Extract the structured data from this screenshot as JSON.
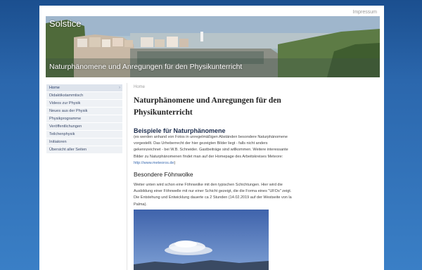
{
  "top_link": "Impressum",
  "header": {
    "title": "Solstice",
    "subtitle": "Naturphänomene und Anregungen für den Physikunterricht"
  },
  "sidebar": {
    "items": [
      {
        "label": "Home",
        "active": true
      },
      {
        "label": "Didaktikstammtisch"
      },
      {
        "label": "Videos zur Physik"
      },
      {
        "label": "Neues aus der Physik"
      },
      {
        "label": "Physikprogramme"
      },
      {
        "label": "Veröffentlichungen"
      },
      {
        "label": "Teilchenphysik"
      },
      {
        "label": "Initiatoren"
      },
      {
        "label": "Übersicht aller Seiten"
      }
    ],
    "active_arrow": "›"
  },
  "main": {
    "breadcrumb": "Home",
    "title": "Naturphänomene und Anregungen für den Physikunterricht",
    "section_heading": "Beispiele für Naturphänomene",
    "intro_text": "(es werden anhand von Fotos in unregelmäßigen Abständen besondere Naturphänomene vorgestellt. Das Urheberrecht der hier gezeigten Bilder liegt - falls nicht anders gekennzeichnet - bei W.B. Schneider. Gastbeiträge sind willkommen. Weitere interessante Bilder zu Naturphänomenen findet man auf der Homepage des Arbeitskreises Meteore: ",
    "intro_link": "http://www.meteoros.de",
    "intro_end": ")",
    "subsection_heading": "Besondere Föhnwolke",
    "body_text": "Weiter unten wird schon eine Föhnwolke mit den typischen Schichtungen. Hier wird die Ausbildung einer Föhnwelle mit nur einer Schicht gezeigt, die die Forma eines \"UFOs\" zeigt. Die Entstehung und Entwicklung dauerte ca 2 Stunden (14.02.2019 auf der Westseite von la Palma)."
  },
  "colors": {
    "background": "#2b67ad",
    "page": "#ffffff",
    "nav_bg": "#eef1f5",
    "link": "#3b6bb0"
  }
}
